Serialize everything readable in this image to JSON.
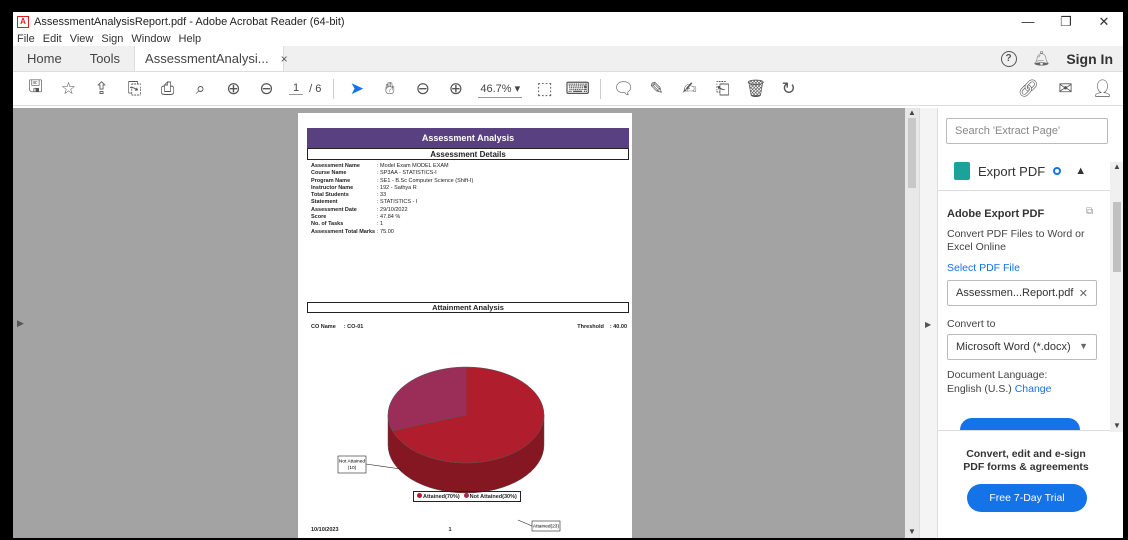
{
  "window": {
    "title": "AssessmentAnalysisReport.pdf - Adobe Acrobat Reader (64-bit)",
    "app_icon": "pdf-icon",
    "controls": [
      "—",
      "❐",
      "✕"
    ]
  },
  "menu": [
    "File",
    "Edit",
    "View",
    "Sign",
    "Window",
    "Help"
  ],
  "tabs": {
    "home": "Home",
    "tools": "Tools",
    "doc": "AssessmentAnalysi...",
    "doc_close": "×",
    "help": "?",
    "signin": "Sign In"
  },
  "toolbar": {
    "page_current": "1",
    "page_total": "/ 6",
    "zoom": "46.7%  ▾"
  },
  "document": {
    "header": "Assessment Analysis",
    "subheader": "Assessment Details",
    "details": [
      {
        "k": "Assessment Name",
        "v": ": Model Exam MODEL EXAM"
      },
      {
        "k": "Course Name",
        "v": ": SP3AA - STATISTICS-I"
      },
      {
        "k": "Program Name",
        "v": ": SE1 - B.Sc Computer Science (Shift-I)"
      },
      {
        "k": "Instructor Name",
        "v": ": 192 - Sathya R"
      },
      {
        "k": "Total Students",
        "v": ": 33"
      },
      {
        "k": "Statement",
        "v": ": STATISTICS - I"
      },
      {
        "k": "Assessment Date",
        "v": ": 29/10/2022"
      },
      {
        "k": "Score",
        "v": ": 47.84  %"
      },
      {
        "k": "No. of Tasks",
        "v": ": 1"
      },
      {
        "k": "Assessment Total Marks",
        "v": ": 75.00"
      }
    ],
    "attainment_header": "Attainment Analysis",
    "co_name_label": "CO Name",
    "co_name_value": ": CO-01",
    "threshold_label": "Threshold",
    "threshold_value": ":   40.00",
    "label_not_attained_1": "Not Attained",
    "label_not_attained_2": "(10)",
    "label_attained": "Attained(23)",
    "legend_attained": "Attained(70%)",
    "legend_not_attained": "Not Attained(30%)",
    "footer_date": "10/10/2023",
    "footer_page": "1"
  },
  "chart_data": {
    "type": "pie",
    "categories": [
      "Attained",
      "Not Attained"
    ],
    "values": [
      23,
      10
    ],
    "percent": [
      70,
      30
    ],
    "colors": [
      "#b01e2d",
      "#9b2e58"
    ]
  },
  "pane": {
    "search_placeholder": "Search 'Extract Page'",
    "export_title": "Export PDF",
    "aep_title": "Adobe Export PDF",
    "desc": "Convert PDF Files to Word or Excel Online",
    "select_file": "Select PDF File",
    "file_name": "Assessmen...Report.pdf",
    "convert_to": "Convert to",
    "format": "Microsoft Word (*.docx)",
    "doc_lang_label": "Document Language:",
    "doc_lang_value": "English (U.S.)",
    "change": "Change",
    "promo": "Convert, edit and e-sign PDF forms & agreements",
    "trial": "Free 7-Day Trial"
  }
}
